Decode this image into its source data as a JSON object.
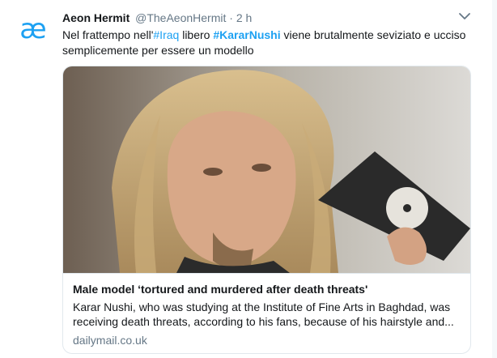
{
  "tweet": {
    "author_name": "Aeon Hermit",
    "handle": "@TheAeonHermit",
    "separator": "·",
    "time": "2 h",
    "avatar_glyph": "æ",
    "avatar_color": "#1da1f2",
    "text_parts": {
      "t1": "Nel frattempo nell'",
      "h1": "#Iraq",
      "t2": " libero ",
      "h2": "#KararNushi",
      "t3": " viene brutalmente seviziato e ucciso semplicemente per essere un modello"
    },
    "menu_icon": "chevron-down-icon"
  },
  "card": {
    "image_description_icon": "photo",
    "title": "Male model ‘tortured and murdered after death threats'",
    "description": "Karar Nushi, who was studying at the Institute of Fine Arts in Baghdad, was receiving death threats, according to his fans, because of his hairstyle and...",
    "domain": "dailymail.co.uk"
  },
  "colors": {
    "link": "#1da1f2",
    "muted": "#657786",
    "border": "#e1e8ed"
  }
}
